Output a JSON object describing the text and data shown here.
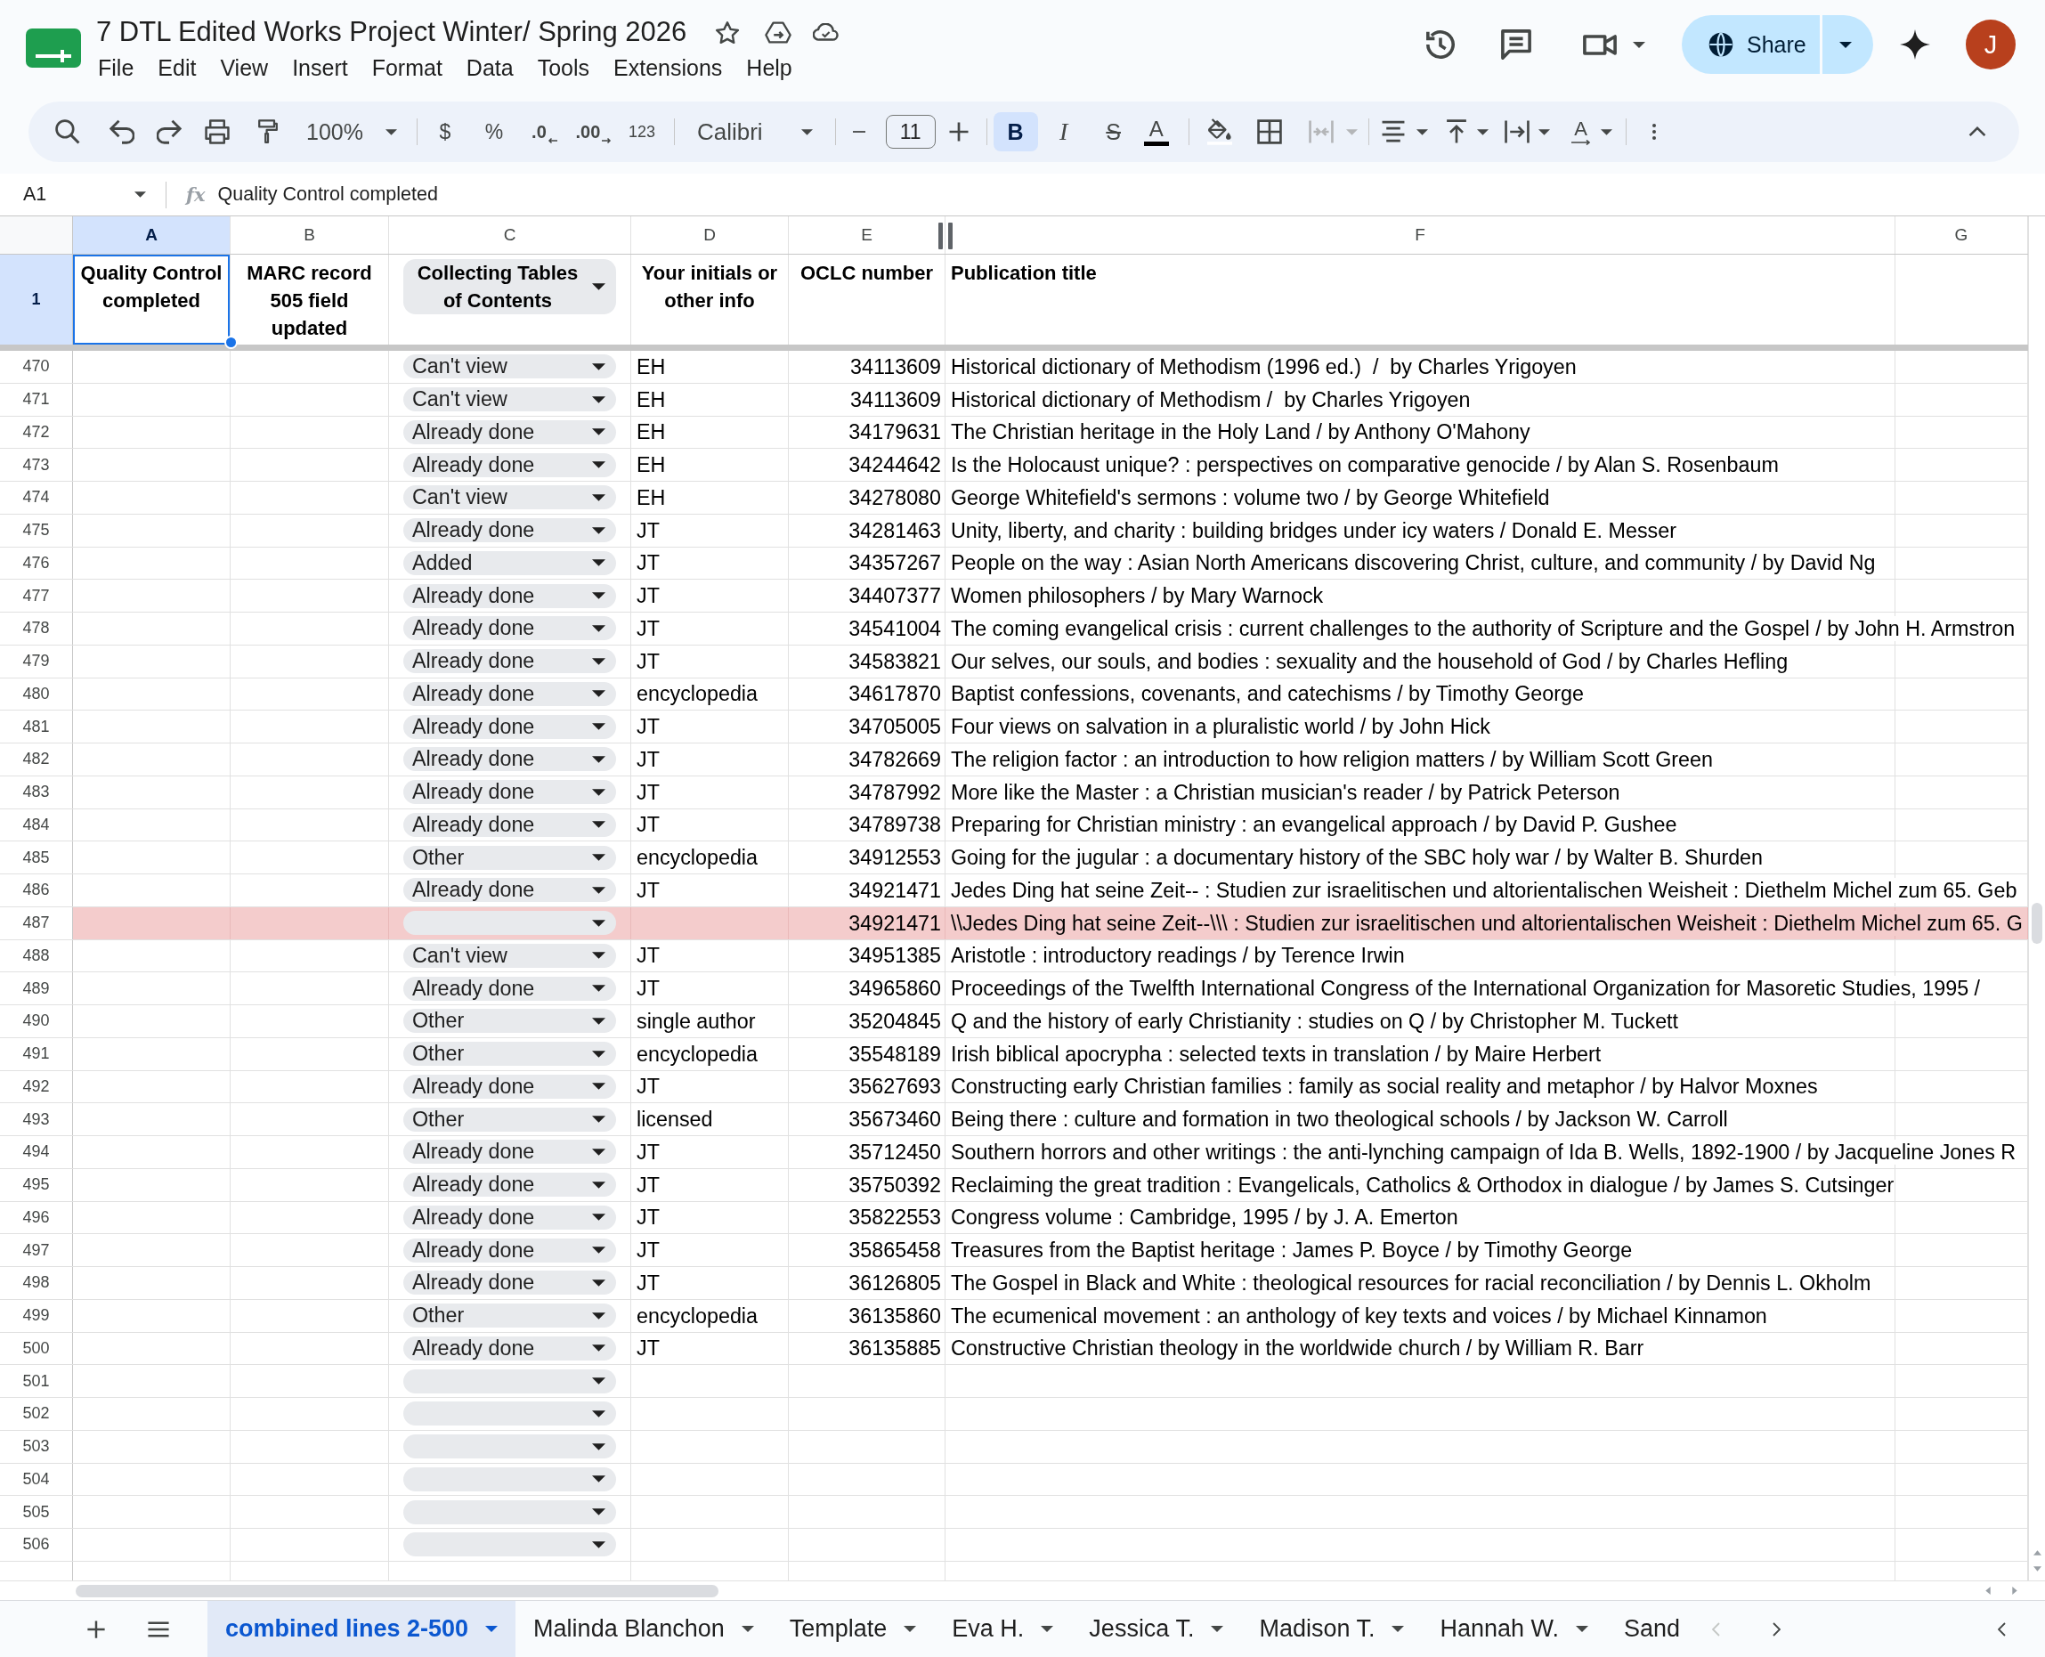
{
  "app": {
    "title": "7 DTL Edited Works Project Winter/ Spring 2026",
    "menu": [
      "File",
      "Edit",
      "View",
      "Insert",
      "Format",
      "Data",
      "Tools",
      "Extensions",
      "Help"
    ],
    "share": "Share",
    "avatar": "J"
  },
  "toolbar": {
    "zoom": "100%",
    "currency": "$",
    "percent": "%",
    "decrease_decimal": ".0",
    "increase_decimal": ".00",
    "number_format": "123",
    "font": "Calibri",
    "font_size": "11",
    "bold": {
      "label": "B",
      "on": true
    },
    "italic": {
      "label": "I",
      "on": false
    },
    "strikethrough": {
      "label": "S",
      "on": false
    },
    "text_color": "A",
    "text_rotation": "A"
  },
  "formula_bar": {
    "cell": "A1",
    "fx": "fx",
    "value": "Quality Control completed"
  },
  "columns": [
    {
      "label": "A",
      "selected": true
    },
    {
      "label": "B",
      "selected": false
    },
    {
      "label": "C",
      "selected": false
    },
    {
      "label": "D",
      "selected": false
    },
    {
      "label": "E",
      "selected": false
    },
    {
      "label": "F",
      "selected": false
    },
    {
      "label": "G",
      "selected": false
    }
  ],
  "header_row": {
    "number": "1",
    "selected": true,
    "cells": [
      {
        "kind": "text",
        "text": "Quality Control completed",
        "selected": true
      },
      {
        "kind": "text",
        "text": "MARC record 505 field updated",
        "selected": false
      },
      {
        "kind": "dropdown",
        "text": "Collecting Tables of Contents",
        "selected": false
      },
      {
        "kind": "text",
        "text": "Your initials or other info",
        "selected": false
      },
      {
        "kind": "text",
        "text": "OCLC number",
        "selected": false
      },
      {
        "kind": "text",
        "text": "Publication title",
        "selected": false
      }
    ]
  },
  "rows": [
    {
      "number": "470",
      "status": "Can't view",
      "initials": "EH",
      "oclc": "34113609",
      "title": "Historical dictionary of Methodism (1996 ed.)  /  by Charles Yrigoyen",
      "highlighted": false
    },
    {
      "number": "471",
      "status": "Can't view",
      "initials": "EH",
      "oclc": "34113609",
      "title": "Historical dictionary of Methodism /  by Charles Yrigoyen",
      "highlighted": false
    },
    {
      "number": "472",
      "status": "Already done",
      "initials": "EH",
      "oclc": "34179631",
      "title": "The Christian heritage in the Holy Land / by Anthony O'Mahony",
      "highlighted": false
    },
    {
      "number": "473",
      "status": "Already done",
      "initials": "EH",
      "oclc": "34244642",
      "title": "Is the Holocaust unique? : perspectives on comparative genocide / by Alan S. Rosenbaum",
      "highlighted": false
    },
    {
      "number": "474",
      "status": "Can't view",
      "initials": "EH",
      "oclc": "34278080",
      "title": "George Whitefield's sermons : volume two / by George Whitefield",
      "highlighted": false
    },
    {
      "number": "475",
      "status": "Already done",
      "initials": "JT",
      "oclc": "34281463",
      "title": "Unity, liberty, and charity : building bridges under icy waters / Donald E. Messer",
      "highlighted": false
    },
    {
      "number": "476",
      "status": "Added",
      "initials": "JT",
      "oclc": "34357267",
      "title": "People on the way : Asian North Americans discovering Christ, culture, and community / by David Ng",
      "highlighted": false
    },
    {
      "number": "477",
      "status": "Already done",
      "initials": "JT",
      "oclc": "34407377",
      "title": "Women philosophers / by Mary Warnock",
      "highlighted": false
    },
    {
      "number": "478",
      "status": "Already done",
      "initials": "JT",
      "oclc": "34541004",
      "title": "The coming evangelical crisis : current challenges to the authority of Scripture and the Gospel / by John H. Armstron",
      "highlighted": false
    },
    {
      "number": "479",
      "status": "Already done",
      "initials": "JT",
      "oclc": "34583821",
      "title": "Our selves, our souls, and bodies : sexuality and the household of God / by Charles Hefling",
      "highlighted": false
    },
    {
      "number": "480",
      "status": "Already done",
      "initials": "encyclopedia",
      "oclc": "34617870",
      "title": "Baptist confessions, covenants, and catechisms / by Timothy George",
      "highlighted": false
    },
    {
      "number": "481",
      "status": "Already done",
      "initials": "JT",
      "oclc": "34705005",
      "title": "Four views on salvation in a pluralistic world / by John Hick",
      "highlighted": false
    },
    {
      "number": "482",
      "status": "Already done",
      "initials": "JT",
      "oclc": "34782669",
      "title": "The religion factor : an introduction to how religion matters / by William Scott Green",
      "highlighted": false
    },
    {
      "number": "483",
      "status": "Already done",
      "initials": "JT",
      "oclc": "34787992",
      "title": "More like the Master : a Christian musician's reader / by Patrick Peterson",
      "highlighted": false
    },
    {
      "number": "484",
      "status": "Already done",
      "initials": "JT",
      "oclc": "34789738",
      "title": "Preparing for Christian ministry : an evangelical approach / by David P. Gushee",
      "highlighted": false
    },
    {
      "number": "485",
      "status": "Other",
      "initials": "encyclopedia",
      "oclc": "34912553",
      "title": "Going for the jugular : a documentary history of the SBC holy war / by Walter B. Shurden",
      "highlighted": false
    },
    {
      "number": "486",
      "status": "Already done",
      "initials": "JT",
      "oclc": "34921471",
      "title": "Jedes Ding hat seine Zeit-- : Studien zur israelitischen und altorientalischen Weisheit : Diethelm Michel zum 65. Geb",
      "highlighted": false
    },
    {
      "number": "487",
      "oclc": "34921471",
      "title": "\\\\Jedes Ding hat seine Zeit--\\\\\\ : Studien zur israelitischen und altorientalischen Weisheit : Diethelm Michel zum 65. G",
      "highlighted": true
    },
    {
      "number": "488",
      "status": "Can't view",
      "initials": "JT",
      "oclc": "34951385",
      "title": "Aristotle : introductory readings / by Terence Irwin",
      "highlighted": false
    },
    {
      "number": "489",
      "status": "Already done",
      "initials": "JT",
      "oclc": "34965860",
      "title": "Proceedings of the Twelfth International Congress of the International Organization for Masoretic Studies, 1995 /",
      "highlighted": false
    },
    {
      "number": "490",
      "status": "Other",
      "initials": "single author",
      "oclc": "35204845",
      "title": "Q and the history of early Christianity : studies on Q / by Christopher M. Tuckett",
      "highlighted": false
    },
    {
      "number": "491",
      "status": "Other",
      "initials": "encyclopedia",
      "oclc": "35548189",
      "title": "Irish biblical apocrypha : selected texts in translation / by Maire Herbert",
      "highlighted": false
    },
    {
      "number": "492",
      "status": "Already done",
      "initials": "JT",
      "oclc": "35627693",
      "title": "Constructing early Christian families : family as social reality and metaphor / by Halvor Moxnes",
      "highlighted": false
    },
    {
      "number": "493",
      "status": "Other",
      "initials": "licensed",
      "oclc": "35673460",
      "title": "Being there : culture and formation in two theological schools / by Jackson W. Carroll",
      "highlighted": false
    },
    {
      "number": "494",
      "status": "Already done",
      "initials": "JT",
      "oclc": "35712450",
      "title": "Southern horrors and other writings : the anti-lynching campaign of Ida B. Wells, 1892-1900 / by Jacqueline Jones R",
      "highlighted": false
    },
    {
      "number": "495",
      "status": "Already done",
      "initials": "JT",
      "oclc": "35750392",
      "title": "Reclaiming the great tradition : Evangelicals, Catholics & Orthodox in dialogue / by James S. Cutsinger",
      "highlighted": false
    },
    {
      "number": "496",
      "status": "Already done",
      "initials": "JT",
      "oclc": "35822553",
      "title": "Congress volume : Cambridge, 1995 / by J. A. Emerton",
      "highlighted": false
    },
    {
      "number": "497",
      "status": "Already done",
      "initials": "JT",
      "oclc": "35865458",
      "title": "Treasures from the Baptist heritage : James P. Boyce / by Timothy George",
      "highlighted": false
    },
    {
      "number": "498",
      "status": "Already done",
      "initials": "JT",
      "oclc": "36126805",
      "title": "The Gospel in Black and White : theological resources for racial reconciliation / by Dennis L. Okholm",
      "highlighted": false
    },
    {
      "number": "499",
      "status": "Other",
      "initials": "encyclopedia",
      "oclc": "36135860",
      "title": "The ecumenical movement : an anthology of key texts and voices / by Michael Kinnamon",
      "highlighted": false
    },
    {
      "number": "500",
      "status": "Already done",
      "initials": "JT",
      "oclc": "36135885",
      "title": "Constructive Christian theology in the worldwide church / by William R. Barr",
      "highlighted": false
    },
    {
      "number": "501",
      "highlighted": false
    },
    {
      "number": "502",
      "highlighted": false
    },
    {
      "number": "503",
      "highlighted": false
    },
    {
      "number": "504",
      "highlighted": false
    },
    {
      "number": "505",
      "highlighted": false
    },
    {
      "number": "506",
      "highlighted": false
    }
  ],
  "sheet_tabs": [
    {
      "label": "combined lines 2-500",
      "selected": true,
      "dropdown": true
    },
    {
      "label": "Malinda Blanchon",
      "selected": false,
      "dropdown": true
    },
    {
      "label": "Template",
      "selected": false,
      "dropdown": true
    },
    {
      "label": "Eva H.",
      "selected": false,
      "dropdown": true
    },
    {
      "label": "Jessica T.",
      "selected": false,
      "dropdown": true
    },
    {
      "label": "Madison T.",
      "selected": false,
      "dropdown": true
    },
    {
      "label": "Hannah W.",
      "selected": false,
      "dropdown": true
    },
    {
      "label": "Sand",
      "selected": false,
      "dropdown": false
    }
  ]
}
